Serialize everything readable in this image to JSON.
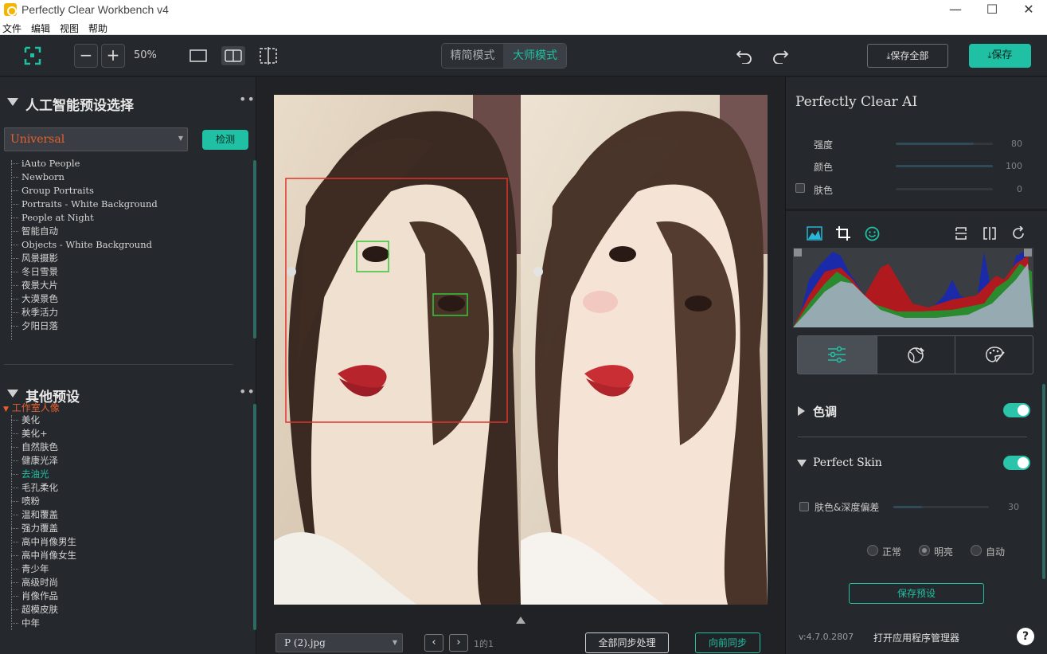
{
  "window": {
    "title": "Perfectly Clear Workbench v4",
    "minimize": "—",
    "maximize": "☐",
    "close": "✕"
  },
  "menu": [
    "文件",
    "编辑",
    "视图",
    "帮助"
  ],
  "toolbar": {
    "zoom_minus": "−",
    "zoom_plus": "+",
    "zoom_level": "50%",
    "mode_simple": "精简模式",
    "mode_master": "大师模式",
    "active_mode": "大师模式",
    "save_all": "保存全部",
    "save": "保存"
  },
  "left": {
    "ai_section_title": "人工智能预设选择",
    "preset_select_value": "Universal",
    "detect_button": "检测",
    "ai_presets": [
      "iAuto People",
      "Newborn",
      "Group Portraits",
      "Portraits - White Background",
      "People at Night",
      "智能自动",
      "Objects - White Background",
      "风景摄影",
      "冬日雪景",
      "夜景大片",
      "大漠景色",
      "秋季活力",
      "夕阳日落"
    ],
    "other_section_title": "其他预设",
    "studio_group": "工作室人像",
    "other_presets": [
      "美化",
      "美化+",
      "自然肤色",
      "健康光泽",
      "去油光",
      "毛孔柔化",
      "喷粉",
      "温和覆盖",
      "强力覆盖",
      "高中肖像男生",
      "高中肖像女生",
      "青少年",
      "高级时尚",
      "肖像作品",
      "超模皮肤",
      "中年"
    ],
    "highlighted_preset": "去油光"
  },
  "center": {
    "file_select_value": "P (2).jpg",
    "page_indicator": "1的1",
    "sync_all_button": "全部同步处理",
    "sync_forward_button": "向前同步"
  },
  "right": {
    "panel_title": "Perfectly Clear AI",
    "sliders": [
      {
        "label": "强度",
        "value": 80
      },
      {
        "label": "颜色",
        "value": 100
      },
      {
        "label": "肤色",
        "value": 0
      }
    ],
    "tone_section": "色调",
    "perfect_skin_section": "Perfect Skin",
    "skin_slider": {
      "label": "肤色&深度偏差",
      "value": 30
    },
    "radio_options": [
      "正常",
      "明亮",
      "自动"
    ],
    "radio_selected": "明亮",
    "save_preset_button": "保存预设",
    "version": "v:4.7.0.2807",
    "open_manager": "打开应用程序管理器",
    "help": "?"
  },
  "colors": {
    "accent": "#1fc0a3",
    "highlight_orange": "#e8602c",
    "face_box": "#e0332e",
    "eye_box": "#35c53a"
  },
  "histogram": {
    "channels": [
      "blue",
      "green",
      "red",
      "luminance"
    ]
  }
}
